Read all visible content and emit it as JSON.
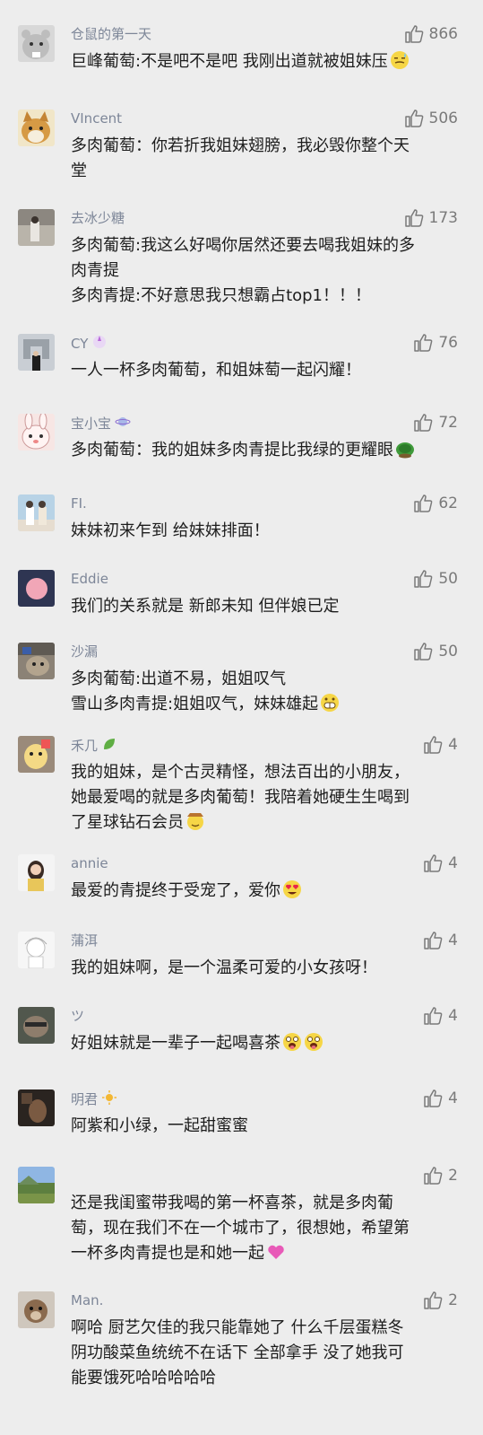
{
  "comments": [
    {
      "user": "仓鼠的第一天",
      "likes": "866",
      "lines": [
        "巨峰葡萄:不是吧不是吧 我刚出道就被姐妹压"
      ],
      "emoji": "sweat",
      "avatar": "hamster"
    },
    {
      "user": "VIncent",
      "likes": "506",
      "lines": [
        "多肉葡萄：你若折我姐妹翅膀，我必毁你整个天",
        "堂"
      ],
      "avatar": "dog"
    },
    {
      "user": "去冰少糖",
      "likes": "173",
      "lines": [
        "多肉葡萄:我这么好喝你居然还要去喝我姐妹的多",
        "肉青提",
        "多肉青提:不好意思我只想霸占top1！！！"
      ],
      "avatar": "street"
    },
    {
      "user": "CY",
      "likes": "76",
      "lines": [
        "一人一杯多肉葡萄，和姐妹萄一起闪耀！"
      ],
      "badge": "unicorn",
      "avatar": "arch"
    },
    {
      "user": "宝小宝",
      "likes": "72",
      "lines": [
        "多肉葡萄：我的姐妹多肉青提比我绿的更耀眼"
      ],
      "badge": "planet",
      "emoji": "turtle",
      "avatar": "rabbit"
    },
    {
      "user": "FI.",
      "likes": "62",
      "lines": [
        "妹妹初来乍到 给妹妹排面！"
      ],
      "avatar": "kids"
    },
    {
      "user": "Eddie",
      "likes": "50",
      "lines": [
        "我们的关系就是 新郎未知 但伴娘已定"
      ],
      "avatar": "pink"
    },
    {
      "user": "沙漏",
      "likes": "50",
      "lines": [
        "多肉葡萄:出道不易，姐姐叹气",
        "雪山多肉青提:姐姐叹气，妹妹雄起"
      ],
      "emoji": "grin",
      "avatar": "cat"
    },
    {
      "user": "禾几",
      "likes": "4",
      "lines": [
        "我的姐妹，是个古灵精怪，想法百出的小朋友，",
        "她最爱喝的就是多肉葡萄！我陪着她硬生生喝到",
        "了星球钻石会员"
      ],
      "badge": "leaf",
      "emoji": "cowboy",
      "avatar": "toy"
    },
    {
      "user": "annie",
      "likes": "4",
      "lines": [
        "最爱的青提终于受宠了，爱你"
      ],
      "emoji": "hearteyes",
      "avatar": "girl"
    },
    {
      "user": "蒲洱",
      "likes": "4",
      "lines": [
        "我的姐妹啊，是一个温柔可爱的小女孩呀！"
      ],
      "avatar": "sketch"
    },
    {
      "user": "ツ",
      "likes": "4",
      "lines": [
        "好姐妹就是一辈子一起喝喜茶"
      ],
      "emoji": "tongue2",
      "avatar": "face"
    },
    {
      "user": "明君",
      "likes": "4",
      "lines": [
        "阿紫和小绿，一起甜蜜蜜"
      ],
      "badge": "sun",
      "avatar": "dark"
    },
    {
      "user": "",
      "likes": "2",
      "lines": [
        "还是我闺蜜带我喝的第一杯喜茶，就是多肉葡",
        "萄，现在我们不在一个城市了，很想她，希望第",
        "一杯多肉青提也是和她一起"
      ],
      "emoji": "heart",
      "avatar": "landscape"
    },
    {
      "user": "Man.",
      "likes": "2",
      "lines": [
        "啊哈 厨艺欠佳的我只能靠她了 什么千层蛋糕冬",
        "阴功酸菜鱼统统不在话下 全部拿手 没了她我可",
        "能要饿死哈哈哈哈哈"
      ],
      "avatar": "puppy"
    }
  ],
  "colors": {
    "background": "#ededed",
    "username": "#7d8698",
    "text": "#1d1d1d",
    "likes": "#7a7a7a"
  }
}
